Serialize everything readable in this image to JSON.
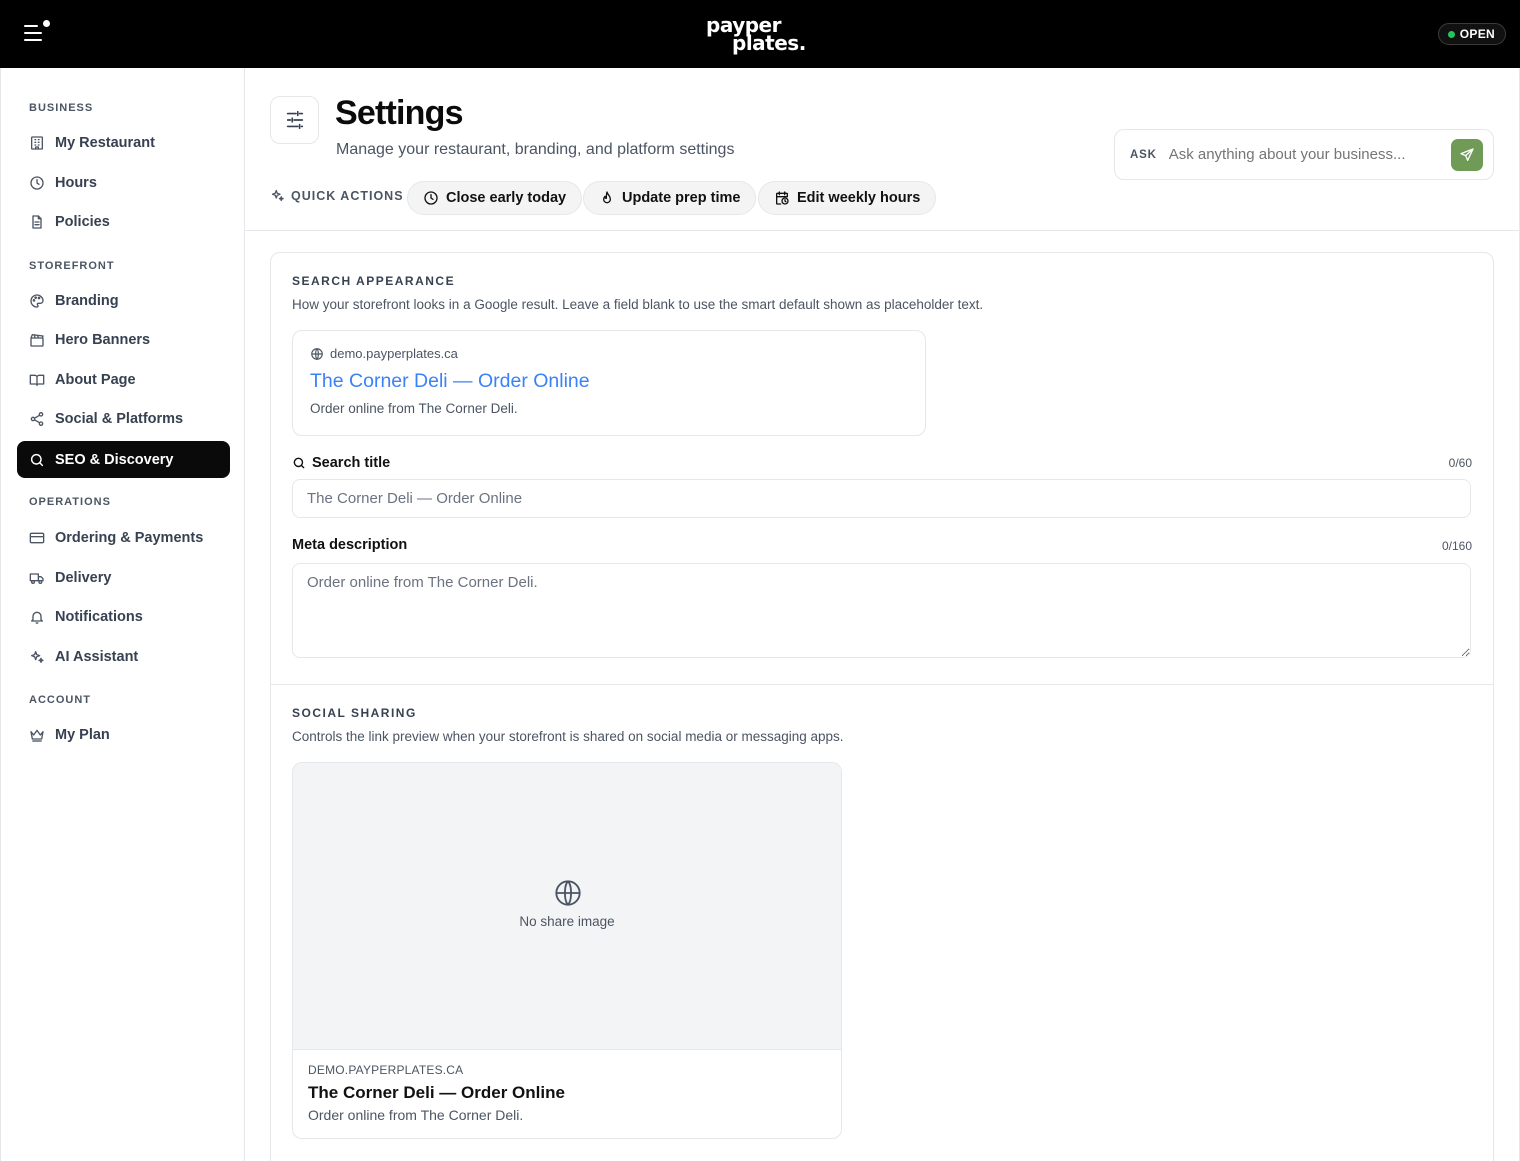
{
  "topbar": {
    "logo_line1": "payper",
    "logo_line2": "plates.",
    "status": "OPEN",
    "status_color": "#22c55e"
  },
  "sidebar": {
    "sections": [
      {
        "label": "BUSINESS",
        "items": [
          {
            "label": "My Restaurant",
            "icon": "building-icon"
          },
          {
            "label": "Hours",
            "icon": "clock-icon"
          },
          {
            "label": "Policies",
            "icon": "document-icon"
          }
        ]
      },
      {
        "label": "STOREFRONT",
        "items": [
          {
            "label": "Branding",
            "icon": "palette-icon"
          },
          {
            "label": "Hero Banners",
            "icon": "clapperboard-icon"
          },
          {
            "label": "About Page",
            "icon": "book-icon"
          },
          {
            "label": "Social & Platforms",
            "icon": "share-icon"
          },
          {
            "label": "SEO & Discovery",
            "icon": "search-icon",
            "active": true
          }
        ]
      },
      {
        "label": "OPERATIONS",
        "items": [
          {
            "label": "Ordering & Payments",
            "icon": "credit-card-icon"
          },
          {
            "label": "Delivery",
            "icon": "truck-icon"
          },
          {
            "label": "Notifications",
            "icon": "bell-icon"
          },
          {
            "label": "AI Assistant",
            "icon": "sparkles-icon"
          }
        ]
      },
      {
        "label": "ACCOUNT",
        "items": [
          {
            "label": "My Plan",
            "icon": "crown-icon"
          }
        ]
      }
    ]
  },
  "header": {
    "title": "Settings",
    "subtitle": "Manage your restaurant, branding, and platform settings",
    "ask_label": "ASK",
    "ask_placeholder": "Ask anything about your business...",
    "ask_button_color": "#6f9b57",
    "quick_actions_label": "QUICK ACTIONS",
    "quick_actions": [
      {
        "label": "Close early today",
        "icon": "clock-icon"
      },
      {
        "label": "Update prep time",
        "icon": "flame-icon"
      },
      {
        "label": "Edit weekly hours",
        "icon": "calendar-clock-icon"
      }
    ]
  },
  "search_appearance": {
    "title": "SEARCH APPEARANCE",
    "description": "How your storefront looks in a Google result. Leave a field blank to use the smart default shown as placeholder text.",
    "preview_url": "demo.payperplates.ca",
    "preview_title": "The Corner Deli — Order Online",
    "preview_description": "Order online from The Corner Deli.",
    "link_color": "#3b82f6",
    "search_title_label": "Search title",
    "search_title_counter": "0/60",
    "search_title_value": "",
    "search_title_placeholder": "The Corner Deli — Order Online",
    "meta_label": "Meta description",
    "meta_counter": "0/160",
    "meta_value": "",
    "meta_placeholder": "Order online from The Corner Deli."
  },
  "social_sharing": {
    "title": "SOCIAL SHARING",
    "description": "Controls the link preview when your storefront is shared on social media or messaging apps.",
    "no_image_text": "No share image",
    "preview_domain": "DEMO.PAYPERPLATES.CA",
    "preview_title": "The Corner Deli — Order Online",
    "preview_description": "Order online from The Corner Deli."
  }
}
